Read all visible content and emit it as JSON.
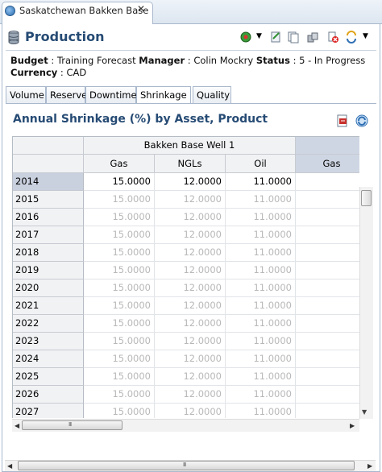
{
  "window": {
    "tab_title": "Saskatchewan Bakken Base"
  },
  "header": {
    "title": "Production"
  },
  "info": {
    "budget_label": "Budget",
    "budget_value": "Training Forecast",
    "manager_label": "Manager",
    "manager_value": "Colin Mockry",
    "status_label": "Status",
    "status_value": "5 - In Progress",
    "currency_label": "Currency",
    "currency_value": "CAD"
  },
  "tabs": [
    "Volume",
    "Reserve",
    "Downtime",
    "Shrinkage",
    "Quality"
  ],
  "active_tab": "Shrinkage",
  "section": {
    "title": "Annual Shrinkage (%) by Asset, Product"
  },
  "grid": {
    "group_header": "Bakken Base Well 1",
    "columns": [
      "Gas",
      "NGLs",
      "Oil",
      "Gas"
    ],
    "rows": [
      {
        "year": "2014",
        "gas": "15.0000",
        "ngls": "12.0000",
        "oil": "11.0000"
      },
      {
        "year": "2015",
        "gas": "15.0000",
        "ngls": "12.0000",
        "oil": "11.0000"
      },
      {
        "year": "2016",
        "gas": "15.0000",
        "ngls": "12.0000",
        "oil": "11.0000"
      },
      {
        "year": "2017",
        "gas": "15.0000",
        "ngls": "12.0000",
        "oil": "11.0000"
      },
      {
        "year": "2018",
        "gas": "15.0000",
        "ngls": "12.0000",
        "oil": "11.0000"
      },
      {
        "year": "2019",
        "gas": "15.0000",
        "ngls": "12.0000",
        "oil": "11.0000"
      },
      {
        "year": "2020",
        "gas": "15.0000",
        "ngls": "12.0000",
        "oil": "11.0000"
      },
      {
        "year": "2021",
        "gas": "15.0000",
        "ngls": "12.0000",
        "oil": "11.0000"
      },
      {
        "year": "2022",
        "gas": "15.0000",
        "ngls": "12.0000",
        "oil": "11.0000"
      },
      {
        "year": "2023",
        "gas": "15.0000",
        "ngls": "12.0000",
        "oil": "11.0000"
      },
      {
        "year": "2024",
        "gas": "15.0000",
        "ngls": "12.0000",
        "oil": "11.0000"
      },
      {
        "year": "2025",
        "gas": "15.0000",
        "ngls": "12.0000",
        "oil": "11.0000"
      },
      {
        "year": "2026",
        "gas": "15.0000",
        "ngls": "12.0000",
        "oil": "11.0000"
      },
      {
        "year": "2027",
        "gas": "15.0000",
        "ngls": "12.0000",
        "oil": "11.0000"
      }
    ]
  },
  "colors": {
    "title_blue": "#264b74",
    "border": "#a9b8cc",
    "selected_header": "#cfd6e3",
    "disabled_text": "#b8b8b8"
  }
}
